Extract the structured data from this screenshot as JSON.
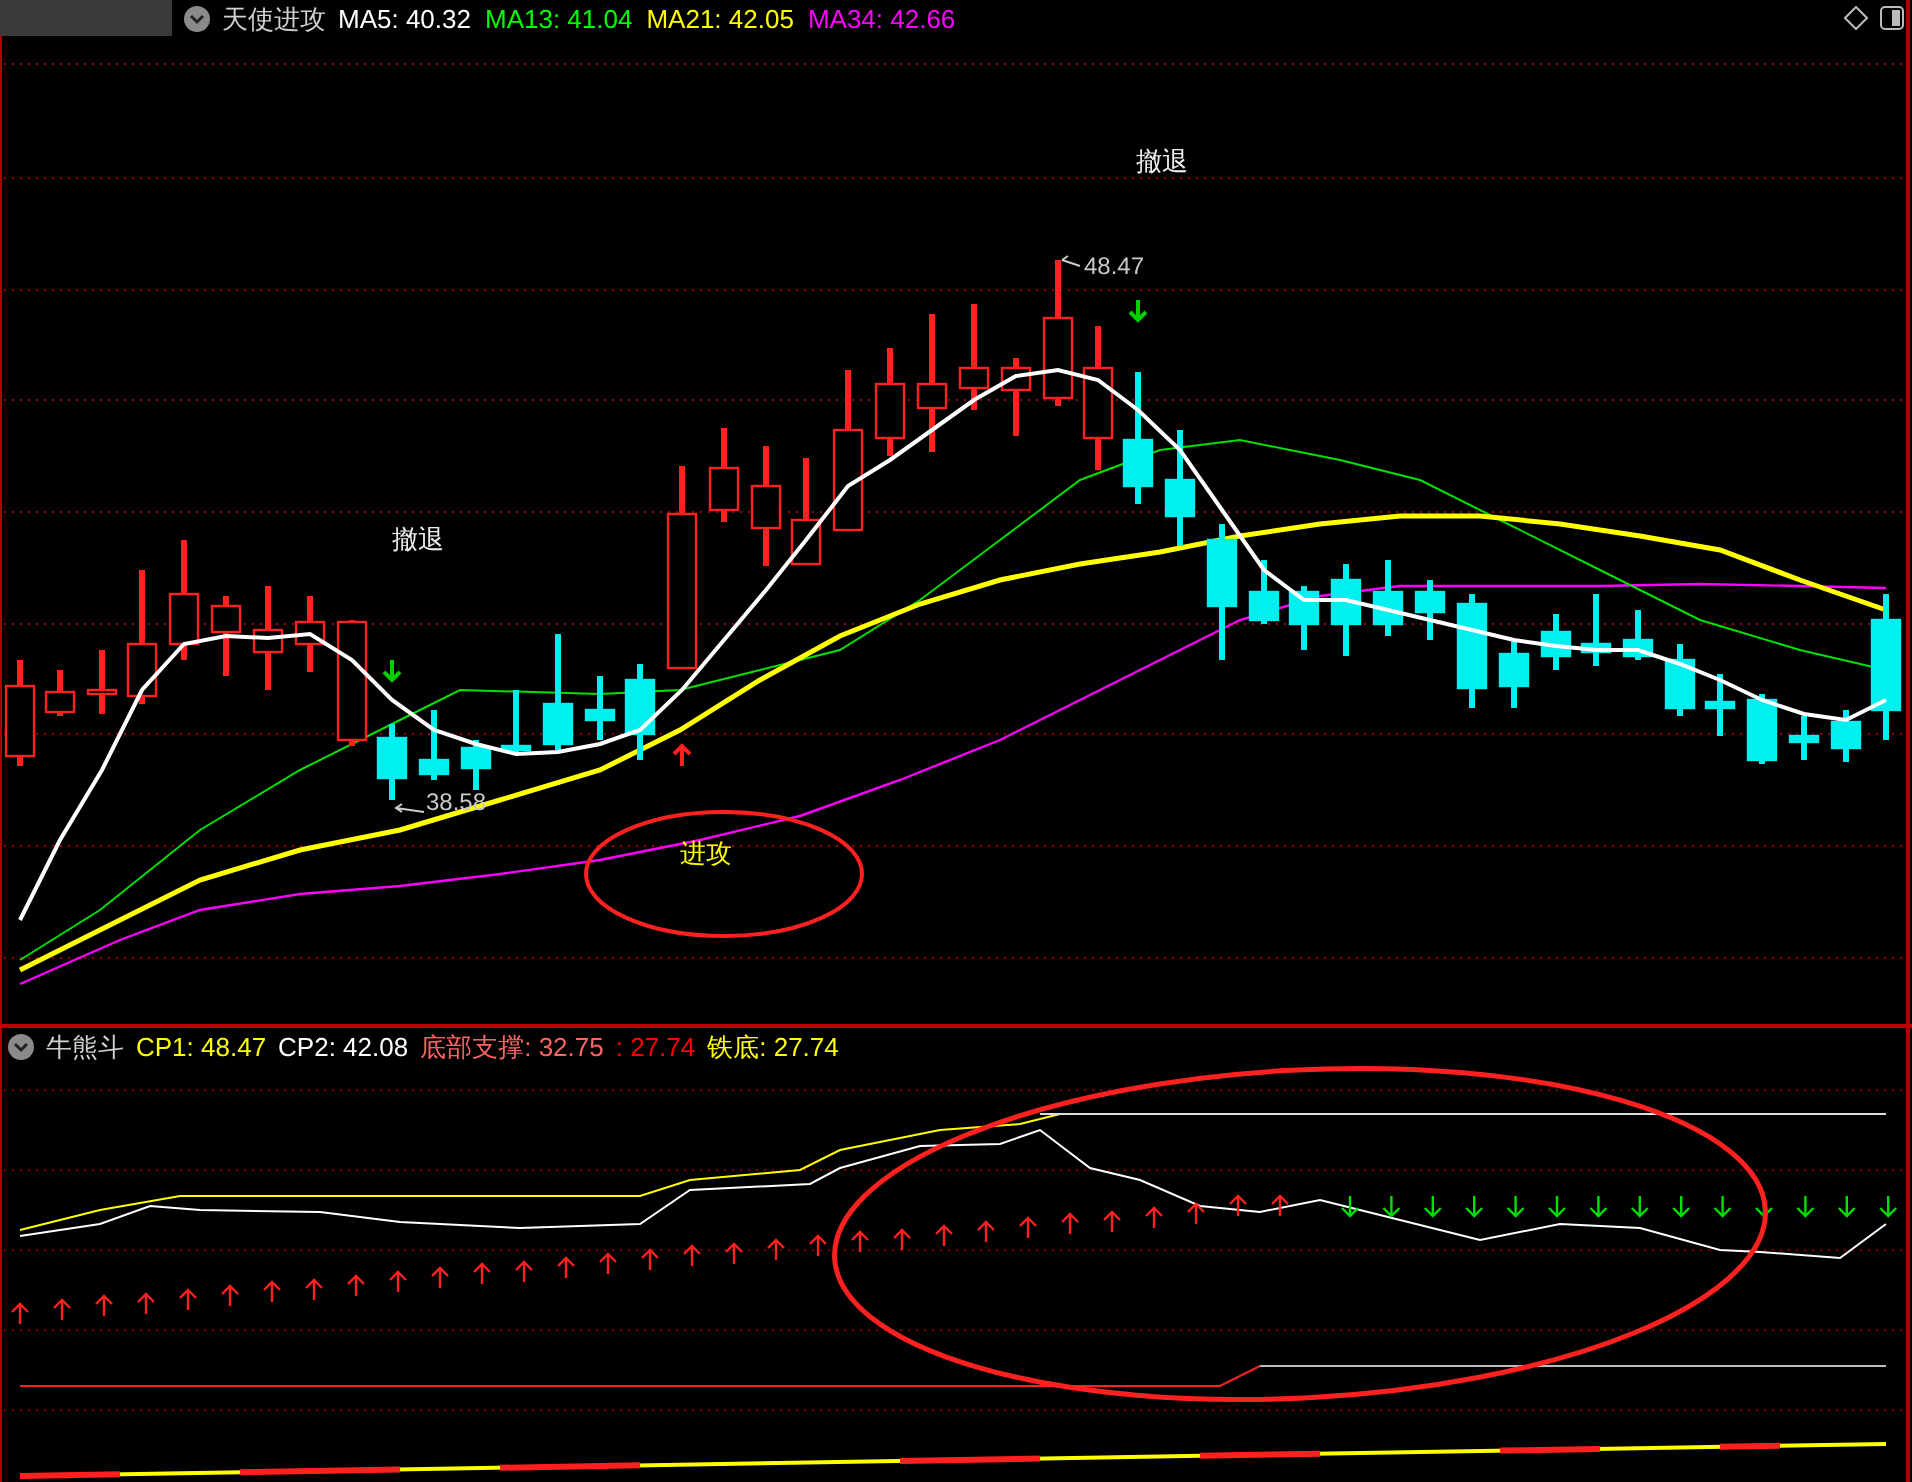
{
  "header": {
    "title": "天使进攻",
    "values": [
      {
        "label": "MA5: 40.32",
        "color": "#ffffff"
      },
      {
        "label": "MA13: 41.04",
        "color": "#00ff00"
      },
      {
        "label": "MA21: 42.05",
        "color": "#ffff00"
      },
      {
        "label": "MA34: 42.66",
        "color": "#ff00ff"
      }
    ]
  },
  "annotations": [
    {
      "kind": "signal",
      "text": "撤退"
    },
    {
      "kind": "signal",
      "text": "撤退"
    },
    {
      "kind": "signal",
      "text": "进攻"
    },
    {
      "kind": "price",
      "text": "48.47"
    },
    {
      "kind": "price",
      "text": "38.58"
    }
  ],
  "lower_panel": {
    "title": "牛熊斗",
    "values": [
      {
        "label": "CP1: 48.47",
        "color": "#ffff00"
      },
      {
        "label": "CP2: 42.08",
        "color": "#ffffff"
      },
      {
        "label": "底部支撑: 32.75",
        "color": "#ff6464"
      },
      {
        "label": ": 27.74",
        "color": "#ff0000"
      },
      {
        "label": "铁底: 27.74",
        "color": "#ffff00"
      }
    ]
  }
}
